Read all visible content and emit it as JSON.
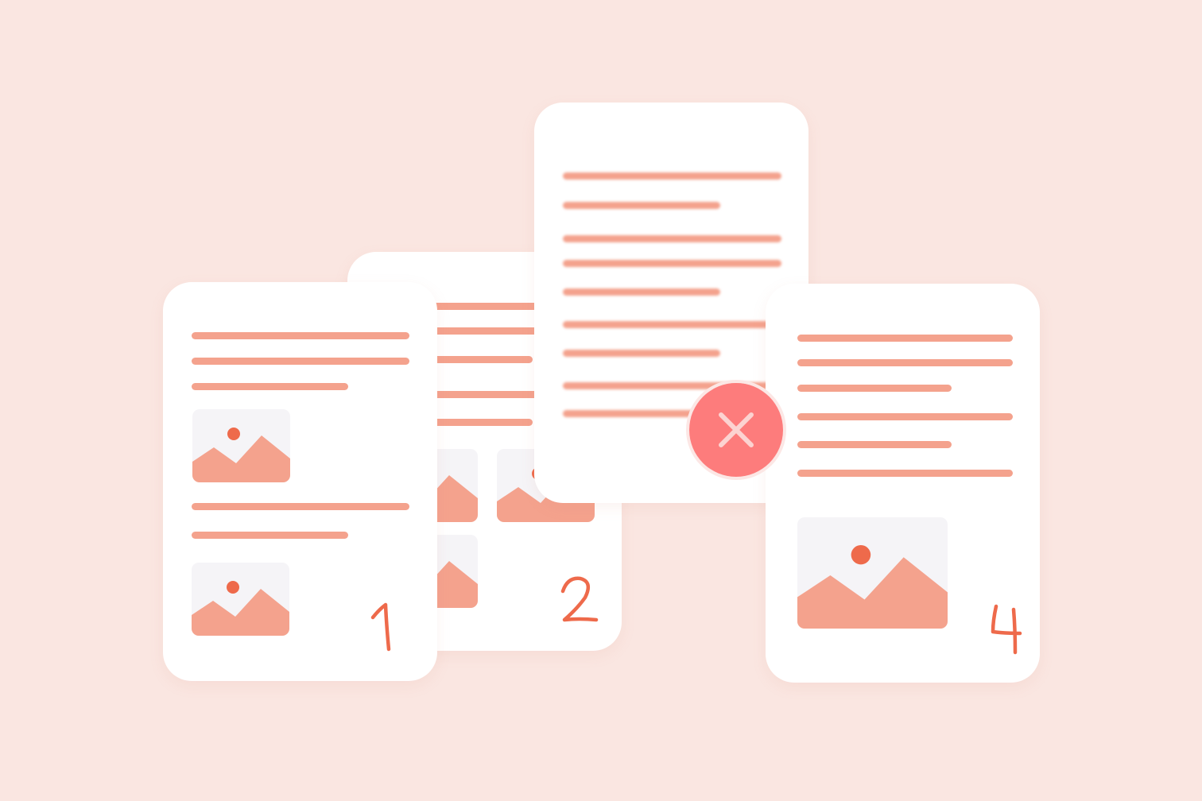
{
  "colors": {
    "background": "#FAE6E1",
    "page": "#FFFFFF",
    "text_line": "#F4A28D",
    "image_placeholder_bg": "#F5F4F7",
    "image_mountain": "#F4A28D",
    "image_sun": "#EE6A4B",
    "page_number": "#EE6A4B",
    "remove_button": "#FD7C7C",
    "remove_button_icon": "#FCD3D1"
  },
  "pages": [
    {
      "number": "1",
      "icon": "image-placeholder-icon"
    },
    {
      "number": "2",
      "icon": "image-placeholder-icon"
    },
    {
      "number": "",
      "removed": true
    },
    {
      "number": "4",
      "icon": "image-placeholder-icon"
    }
  ],
  "remove_button": {
    "icon": "close-icon"
  }
}
